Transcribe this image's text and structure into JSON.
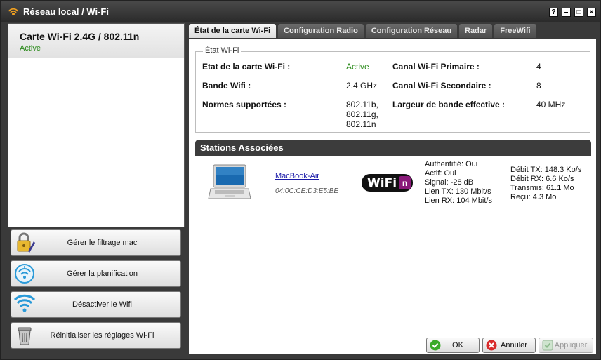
{
  "window": {
    "title": "Réseau local / Wi-Fi",
    "controls": [
      "?",
      "–",
      "□",
      "×"
    ]
  },
  "left": {
    "card_name": "Carte Wi-Fi 2.4G / 802.11n",
    "card_status": "Active",
    "actions": [
      {
        "label": "Gérer le filtrage mac",
        "icon": "lock-pencil-icon"
      },
      {
        "label": "Gérer la planification",
        "icon": "wifi-clock-icon"
      },
      {
        "label": "Désactiver le Wifi",
        "icon": "wifi-icon"
      },
      {
        "label": "Réinitialiser les réglages Wi-Fi",
        "icon": "trash-can-icon"
      }
    ]
  },
  "tabs": [
    {
      "label": "État de la carte Wi-Fi",
      "active": true
    },
    {
      "label": "Configuration Radio",
      "active": false
    },
    {
      "label": "Configuration Réseau",
      "active": false
    },
    {
      "label": "Radar",
      "active": false
    },
    {
      "label": "FreeWifi",
      "active": false
    }
  ],
  "status": {
    "legend": "État Wi-Fi",
    "card_state_label": "Etat de la carte Wi-Fi :",
    "card_state_value": "Active",
    "band_label": "Bande Wifi :",
    "band_value": "2.4 GHz",
    "norms_label": "Normes supportées :",
    "norms_values": [
      "802.11b,",
      "802.11g,",
      "802.11n"
    ],
    "primary_channel_label": "Canal Wi-Fi Primaire :",
    "primary_channel_value": "4",
    "secondary_channel_label": "Canal Wi-Fi Secondaire :",
    "secondary_channel_value": "8",
    "bandwidth_label": "Largeur de bande effective :",
    "bandwidth_value": "40 MHz"
  },
  "stations": {
    "header": "Stations Associées",
    "items": [
      {
        "device": "MacBook-Air",
        "mac": "04:0C:CE:D3:E5:BE",
        "badge": "WiFi",
        "badge_suffix": "n",
        "info": [
          "Authentifié: Oui",
          "Actif: Oui",
          "Signal: -28 dB",
          "Lien TX: 130 Mbit/s",
          "Lien RX: 104 Mbit/s"
        ],
        "traffic": [
          "Débit TX: 148.3 Ko/s",
          "Débit RX: 6.6 Ko/s",
          "Transmis: 61.1 Mo",
          "Reçu: 4.3 Mo"
        ]
      }
    ]
  },
  "buttons": {
    "ok": "OK",
    "cancel": "Annuler",
    "apply": "Appliquer"
  },
  "colors": {
    "active_green": "#2a8a1a",
    "link_blue": "#1a1aa8",
    "wifi_badge_magenta": "#8a1a7a"
  }
}
